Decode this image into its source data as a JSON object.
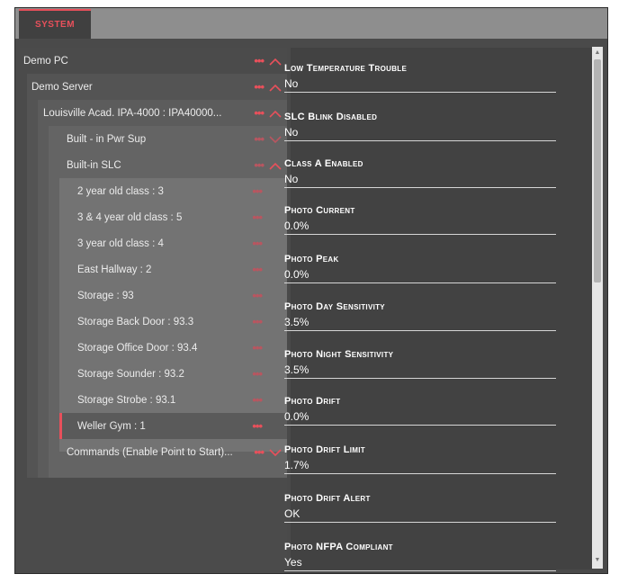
{
  "tab": {
    "label": "SYSTEM"
  },
  "tree": {
    "items": [
      {
        "label": "Demo PC",
        "chevron": "up"
      },
      {
        "label": "Demo Server",
        "chevron": "up"
      },
      {
        "label": "Louisville Acad. IPA-4000 : IPA40000...",
        "chevron": "up"
      },
      {
        "label": "Built - in Pwr Sup",
        "chevron": "down"
      },
      {
        "label": "Built-in SLC",
        "chevron": "up"
      },
      {
        "label": "2 year old class : 3"
      },
      {
        "label": "3 & 4 year old class : 5"
      },
      {
        "label": "3 year old class : 4"
      },
      {
        "label": "East Hallway : 2"
      },
      {
        "label": "Storage : 93"
      },
      {
        "label": "Storage Back Door : 93.3"
      },
      {
        "label": "Storage Office Door : 93.4"
      },
      {
        "label": "Storage Sounder : 93.2"
      },
      {
        "label": "Storage Strobe : 93.1"
      },
      {
        "label": "Weller Gym : 1",
        "selected": true
      },
      {
        "label": "Commands (Enable Point to Start)...",
        "chevron": "down"
      }
    ]
  },
  "properties": [
    {
      "label": "Low Temperature Trouble",
      "value": "No"
    },
    {
      "label": "SLC Blink Disabled",
      "value": "No"
    },
    {
      "label": "Class A Enabled",
      "value": "No"
    },
    {
      "label": "Photo Current",
      "value": "0.0%"
    },
    {
      "label": "Photo Peak",
      "value": "0.0%"
    },
    {
      "label": "Photo Day Sensitivity",
      "value": "3.5%"
    },
    {
      "label": "Photo Night Sensitivity",
      "value": "3.5%"
    },
    {
      "label": "Photo Drift",
      "value": "0.0%"
    },
    {
      "label": "Photo Drift Limit",
      "value": "1.7%"
    },
    {
      "label": "Photo Drift Alert",
      "value": "OK"
    },
    {
      "label": "Photo NFPA Compliant",
      "value": "Yes"
    }
  ],
  "icons": {
    "more": "more-dots-icon",
    "expand": "chevron-up-icon",
    "collapse": "chevron-down-icon"
  },
  "colors": {
    "accent": "#e8505b"
  }
}
